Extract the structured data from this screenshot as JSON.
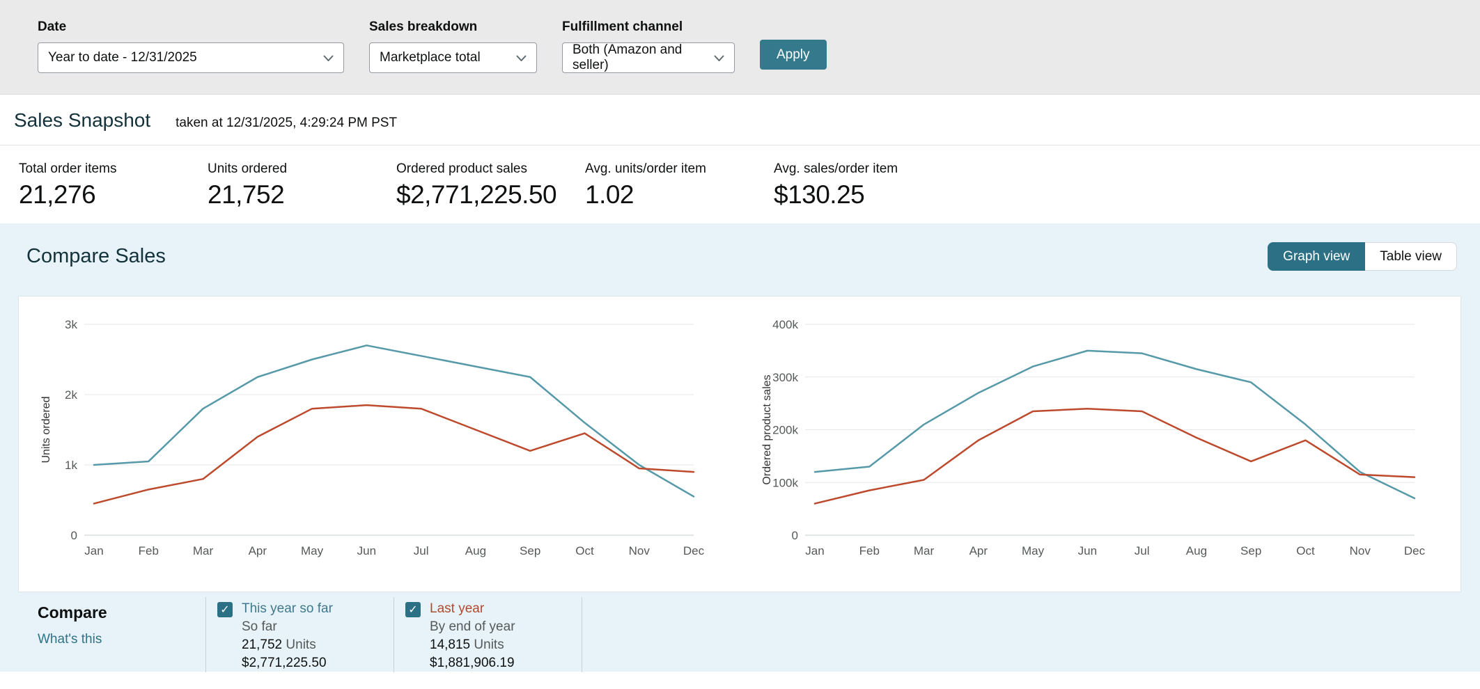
{
  "filters": {
    "date": {
      "label": "Date",
      "value": "Year to date - 12/31/2025"
    },
    "sales_breakdown": {
      "label": "Sales breakdown",
      "value": "Marketplace total"
    },
    "fulfillment_channel": {
      "label": "Fulfillment channel",
      "value": "Both (Amazon and seller)"
    },
    "apply_label": "Apply"
  },
  "snapshot": {
    "title": "Sales Snapshot",
    "taken_at": "taken at 12/31/2025, 4:29:24 PM PST",
    "metrics": [
      {
        "label": "Total order items",
        "value": "21,276"
      },
      {
        "label": "Units ordered",
        "value": "21,752"
      },
      {
        "label": "Ordered product sales",
        "value": "$2,771,225.50"
      },
      {
        "label": "Avg. units/order item",
        "value": "1.02"
      },
      {
        "label": "Avg. sales/order item",
        "value": "$130.25"
      }
    ]
  },
  "compare_sales": {
    "title": "Compare Sales",
    "view_toggle": {
      "graph": "Graph view",
      "table": "Table view",
      "active": "graph"
    },
    "compare_panel": {
      "title": "Compare",
      "whats_this": "What's this",
      "series": [
        {
          "name": "This year so far",
          "sub": "So far",
          "units": "21,752",
          "units_suffix": "Units",
          "sales": "$2,771,225.50",
          "text_color": "#40798b",
          "checked": true
        },
        {
          "name": "Last year",
          "sub": "By end of year",
          "units": "14,815",
          "units_suffix": "Units",
          "sales": "$1,881,906.19",
          "text_color": "#b1492e",
          "checked": true
        }
      ]
    }
  },
  "chart_data": [
    {
      "type": "line",
      "title": "Units ordered by month",
      "ylabel": "Units ordered",
      "x": [
        "Jan",
        "Feb",
        "Mar",
        "Apr",
        "May",
        "Jun",
        "Jul",
        "Aug",
        "Sep",
        "Oct",
        "Nov",
        "Dec"
      ],
      "ylim": [
        0,
        3000
      ],
      "grid": true,
      "yticks": [
        {
          "v": 0,
          "label": "0"
        },
        {
          "v": 1000,
          "label": "1k"
        },
        {
          "v": 2000,
          "label": "2k"
        },
        {
          "v": 3000,
          "label": "3k"
        }
      ],
      "series": [
        {
          "name": "This year so far",
          "color": "#5699a8",
          "values": [
            1000,
            1050,
            1800,
            2250,
            2500,
            2700,
            2550,
            2400,
            2250,
            1600,
            1000,
            550
          ]
        },
        {
          "name": "Last year",
          "color": "#bd4a2d",
          "values": [
            450,
            650,
            800,
            1400,
            1800,
            1850,
            1800,
            1500,
            1200,
            1450,
            950,
            900
          ]
        }
      ]
    },
    {
      "type": "line",
      "title": "Ordered product sales by month",
      "ylabel": "Ordered product sales",
      "x": [
        "Jan",
        "Feb",
        "Mar",
        "Apr",
        "May",
        "Jun",
        "Jul",
        "Aug",
        "Sep",
        "Oct",
        "Nov",
        "Dec"
      ],
      "ylim": [
        0,
        400000
      ],
      "grid": true,
      "yticks": [
        {
          "v": 0,
          "label": "0"
        },
        {
          "v": 100000,
          "label": "100k"
        },
        {
          "v": 200000,
          "label": "200k"
        },
        {
          "v": 300000,
          "label": "300k"
        },
        {
          "v": 400000,
          "label": "400k"
        }
      ],
      "series": [
        {
          "name": "This year so far",
          "color": "#5699a8",
          "values": [
            120000,
            130000,
            210000,
            270000,
            320000,
            350000,
            345000,
            315000,
            290000,
            210000,
            120000,
            70000
          ]
        },
        {
          "name": "Last year",
          "color": "#bd4a2d",
          "values": [
            60000,
            85000,
            105000,
            180000,
            235000,
            240000,
            235000,
            185000,
            140000,
            180000,
            115000,
            110000
          ]
        }
      ]
    }
  ],
  "colors": {
    "accent_teal": "#2b7084",
    "apply_button": "#357a8c",
    "chart_this_year": "#5699a8",
    "chart_last_year": "#bd4a2d",
    "section_bg": "#e7f3f8",
    "filter_bar_bg": "#eaeaea",
    "checkbox": "#2b7084"
  }
}
